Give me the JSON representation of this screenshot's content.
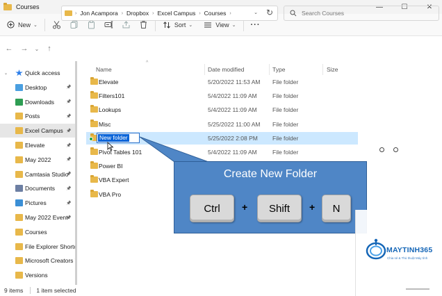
{
  "window": {
    "title": "Courses",
    "minimize": "—",
    "maximize": "☐",
    "close": "✕"
  },
  "toolbar": {
    "new_label": "New",
    "sort_label": "Sort",
    "view_label": "View",
    "more_label": "···",
    "dropdown_glyph": "⌄"
  },
  "address": {
    "crumbs": [
      "Jon Acampora",
      "Dropbox",
      "Excel Campus",
      "Courses"
    ],
    "separator": "›",
    "dropdown_glyph": "⌄",
    "refresh_glyph": "↻"
  },
  "search": {
    "placeholder": "Search Courses"
  },
  "nav": {
    "back": "←",
    "forward": "→",
    "history": "⌄",
    "up": "↑"
  },
  "navpane": {
    "items": [
      {
        "label": "Quick access",
        "color": "#2b7de9",
        "pinned": false,
        "expander": "⌄"
      },
      {
        "label": "Desktop",
        "color": "#4a9fe0",
        "pinned": true
      },
      {
        "label": "Downloads",
        "color": "#2e9d53",
        "pinned": true
      },
      {
        "label": "Posts",
        "color": "#e8b84a",
        "pinned": true
      },
      {
        "label": "Excel Campus",
        "color": "#e8b84a",
        "pinned": true
      },
      {
        "label": "Elevate",
        "color": "#e8b84a",
        "pinned": true
      },
      {
        "label": "May 2022",
        "color": "#e8b84a",
        "pinned": true
      },
      {
        "label": "Camtasia Studio",
        "color": "#e8b84a",
        "pinned": true
      },
      {
        "label": "Documents",
        "color": "#6d7fa3",
        "pinned": true
      },
      {
        "label": "Pictures",
        "color": "#3b8fd6",
        "pinned": true
      },
      {
        "label": "May 2022 Event",
        "color": "#e8b84a",
        "pinned": true
      },
      {
        "label": "Courses",
        "color": "#e8b84a",
        "pinned": false
      },
      {
        "label": "File Explorer Shortcu",
        "color": "#e8b84a",
        "pinned": false
      },
      {
        "label": "Microsoft Creators V",
        "color": "#e8b84a",
        "pinned": false
      },
      {
        "label": "Versions",
        "color": "#e8b84a",
        "pinned": false
      }
    ],
    "pin_glyph": "📌"
  },
  "columns": {
    "name": "Name",
    "date": "Date modified",
    "type": "Type",
    "size": "Size",
    "sort_indicator": "^"
  },
  "files": [
    {
      "name": "Elevate",
      "date": "5/20/2022 11:53 AM",
      "type": "File folder"
    },
    {
      "name": "Filters101",
      "date": "5/4/2022 11:09 AM",
      "type": "File folder"
    },
    {
      "name": "Lookups",
      "date": "5/4/2022 11:09 AM",
      "type": "File folder"
    },
    {
      "name": "Misc",
      "date": "5/25/2022 11:00 AM",
      "type": "File folder"
    },
    {
      "name": "New folder",
      "date": "5/25/2022 2:08 PM",
      "type": "File folder",
      "selected": true,
      "renaming": true
    },
    {
      "name": "Pivot Tables 101",
      "date": "5/4/2022 11:09 AM",
      "type": "File folder"
    },
    {
      "name": "Power BI",
      "date": "",
      "type": ""
    },
    {
      "name": "VBA Expert",
      "date": "",
      "type": ""
    },
    {
      "name": "VBA Pro",
      "date": "",
      "type": ""
    }
  ],
  "status": {
    "count": "9 items",
    "selection": "1 item selected"
  },
  "callout": {
    "title": "Create New Folder",
    "keys": [
      "Ctrl",
      "Shift",
      "N"
    ],
    "plus": "+"
  },
  "watermark": {
    "brand": "MAYTINH365",
    "tagline": "Chia sẻ & Thủ thuật Máy tính"
  },
  "colors": {
    "accent": "#0a64d8",
    "selection": "#cce8ff",
    "callout": "#4f86c6",
    "folder": "#e8b84a"
  }
}
